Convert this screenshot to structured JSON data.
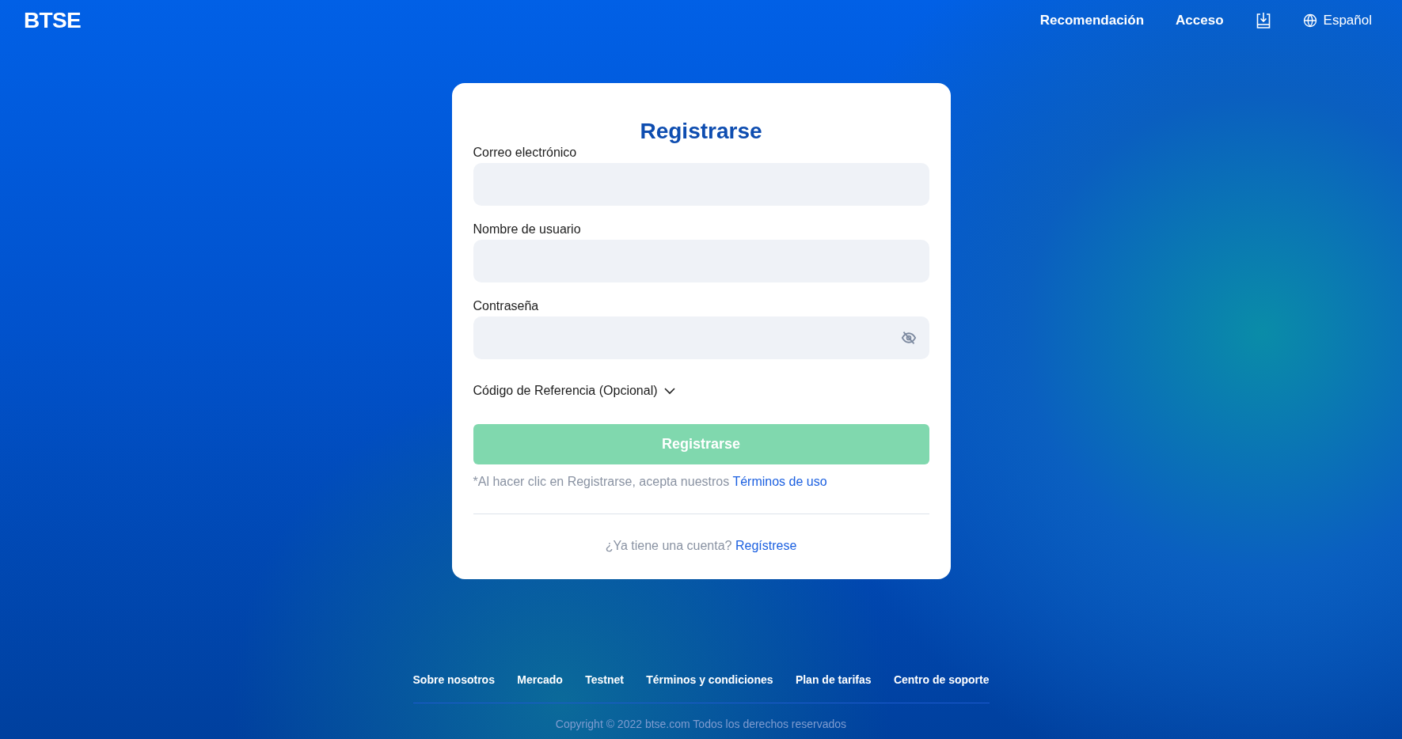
{
  "header": {
    "logo": "BTSE",
    "nav": [
      {
        "kind": "link",
        "label": "Recomendación"
      },
      {
        "kind": "link",
        "label": "Acceso"
      },
      {
        "kind": "download"
      },
      {
        "kind": "language",
        "label": "Español"
      }
    ]
  },
  "form": {
    "title": "Registrarse",
    "fields": [
      {
        "label": "Correo electrónico",
        "kind": "text"
      },
      {
        "label": "Nombre de usuario",
        "kind": "text"
      },
      {
        "label": "Contraseña",
        "kind": "password"
      }
    ],
    "referral": {
      "label": "Código de Referencia (Opcional)",
      "expanded": false
    },
    "submit": {
      "label": "Registrarse",
      "disabled": true
    },
    "terms": {
      "text": "*Al hacer clic en Registrarse, acepta nuestros",
      "link": "Términos de uso"
    },
    "account": {
      "text": "¿Ya tiene una cuenta?",
      "link": "Regístrese"
    }
  },
  "footer": {
    "links": [
      "Sobre nosotros",
      "Mercado",
      "Testnet",
      "Términos y condiciones",
      "Plan de tarifas",
      "Centro de soporte"
    ],
    "copyright": "Copyright © 2022 btse.com Todos los derechos reservados"
  }
}
